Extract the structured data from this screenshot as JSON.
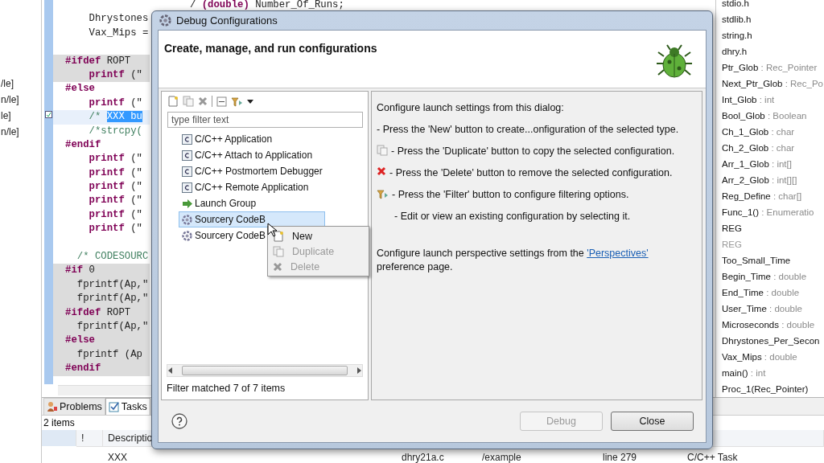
{
  "explorer": {
    "items": [
      "/le]",
      "n/le]",
      "le]",
      "n/le]"
    ]
  },
  "editor": {
    "lines": [
      {
        "shaded": false,
        "current": false,
        "parts": [
          {
            "kind": "plain",
            "text": "                     / "
          },
          {
            "kind": "kw",
            "text": "(double)"
          },
          {
            "kind": "plain",
            "text": " Number_Of_Runs;"
          }
        ]
      },
      {
        "shaded": false,
        "current": false,
        "parts": [
          {
            "kind": "plain",
            "text": "    Dhrystones"
          }
        ]
      },
      {
        "shaded": false,
        "current": false,
        "parts": [
          {
            "kind": "plain",
            "text": "    Vax_Mips ="
          }
        ]
      },
      {
        "shaded": false,
        "current": false
      },
      {
        "shaded": true,
        "current": false,
        "parts": [
          {
            "kind": "kw",
            "text": "#ifdef"
          },
          {
            "kind": "plain",
            "text": " ROPT"
          }
        ]
      },
      {
        "shaded": true,
        "current": false,
        "parts": [
          {
            "kind": "kw",
            "text": "    printf"
          },
          {
            "kind": "plain",
            "text": " (\""
          }
        ]
      },
      {
        "shaded": false,
        "current": false,
        "parts": [
          {
            "kind": "kw",
            "text": "#else"
          }
        ]
      },
      {
        "shaded": false,
        "current": false,
        "parts": [
          {
            "kind": "kw",
            "text": "    printf"
          },
          {
            "kind": "plain",
            "text": " (\""
          }
        ]
      },
      {
        "shaded": false,
        "current": true,
        "parts": [
          {
            "kind": "comment",
            "text": "    /* "
          },
          {
            "kind": "sel",
            "text": "XXX bu"
          }
        ]
      },
      {
        "shaded": false,
        "current": false,
        "parts": [
          {
            "kind": "comment",
            "text": "    /*strcpy("
          }
        ]
      },
      {
        "shaded": false,
        "current": false,
        "parts": [
          {
            "kind": "kw",
            "text": "#endif"
          }
        ]
      },
      {
        "shaded": false,
        "current": false,
        "parts": [
          {
            "kind": "kw",
            "text": "    printf"
          },
          {
            "kind": "plain",
            "text": " (\""
          }
        ]
      },
      {
        "shaded": false,
        "current": false,
        "parts": [
          {
            "kind": "kw",
            "text": "    printf"
          },
          {
            "kind": "plain",
            "text": " (\""
          }
        ]
      },
      {
        "shaded": false,
        "current": false,
        "parts": [
          {
            "kind": "kw",
            "text": "    printf"
          },
          {
            "kind": "plain",
            "text": " (\""
          }
        ]
      },
      {
        "shaded": false,
        "current": false,
        "parts": [
          {
            "kind": "kw",
            "text": "    printf"
          },
          {
            "kind": "plain",
            "text": " (\""
          }
        ]
      },
      {
        "shaded": false,
        "current": false,
        "parts": [
          {
            "kind": "kw",
            "text": "    printf"
          },
          {
            "kind": "plain",
            "text": " (\""
          }
        ]
      },
      {
        "shaded": false,
        "current": false,
        "parts": [
          {
            "kind": "kw",
            "text": "    printf"
          },
          {
            "kind": "plain",
            "text": " (\""
          }
        ]
      },
      {
        "shaded": false,
        "current": false
      },
      {
        "shaded": false,
        "current": false,
        "parts": [
          {
            "kind": "comment",
            "text": "  /* CODESOURC"
          }
        ]
      },
      {
        "shaded": true,
        "current": false,
        "parts": [
          {
            "kind": "kw",
            "text": "#if"
          },
          {
            "kind": "plain",
            "text": " 0"
          }
        ]
      },
      {
        "shaded": true,
        "current": false,
        "parts": [
          {
            "kind": "plain",
            "text": "  fprintf(Ap,\""
          }
        ]
      },
      {
        "shaded": true,
        "current": false,
        "parts": [
          {
            "kind": "plain",
            "text": "  fprintf(Ap,\""
          }
        ]
      },
      {
        "shaded": true,
        "current": false,
        "parts": [
          {
            "kind": "kw",
            "text": "#ifdef"
          },
          {
            "kind": "plain",
            "text": " ROPT"
          }
        ]
      },
      {
        "shaded": true,
        "current": false,
        "parts": [
          {
            "kind": "plain",
            "text": "  fprintf(Ap,\""
          }
        ]
      },
      {
        "shaded": true,
        "current": false,
        "parts": [
          {
            "kind": "kw",
            "text": "#else"
          }
        ]
      },
      {
        "shaded": true,
        "current": false,
        "parts": [
          {
            "kind": "plain",
            "text": "  fprintf (Ap"
          }
        ]
      },
      {
        "shaded": true,
        "current": false,
        "parts": [
          {
            "kind": "kw",
            "text": "#endif"
          }
        ]
      }
    ]
  },
  "outline": {
    "items": [
      {
        "name": "stdio.h",
        "disabled": false
      },
      {
        "name": "stdlib.h",
        "disabled": false
      },
      {
        "name": "string.h",
        "disabled": false
      },
      {
        "name": "dhry.h",
        "disabled": false
      },
      {
        "name": "Ptr_Glob",
        "type": ": Rec_Pointer",
        "disabled": false
      },
      {
        "name": "Next_Ptr_Glob",
        "type": ": Rec_Po",
        "disabled": false
      },
      {
        "name": "Int_Glob",
        "type": ": int",
        "disabled": false
      },
      {
        "name": "Bool_Glob",
        "type": ": Boolean",
        "disabled": false
      },
      {
        "name": "Ch_1_Glob",
        "type": ": char",
        "disabled": false
      },
      {
        "name": "Ch_2_Glob",
        "type": ": char",
        "disabled": false
      },
      {
        "name": "Arr_1_Glob",
        "type": ": int[]",
        "disabled": false
      },
      {
        "name": "Arr_2_Glob",
        "type": ": int[][]",
        "disabled": false
      },
      {
        "name": "Reg_Define",
        "type": ": char[]",
        "disabled": false
      },
      {
        "name": "Func_1()",
        "type": ": Enumeratio",
        "disabled": false
      },
      {
        "name": "REG",
        "disabled": false
      },
      {
        "name": "REG",
        "disabled": true
      },
      {
        "name": "Too_Small_Time",
        "disabled": false
      },
      {
        "name": "Begin_Time",
        "type": ": double",
        "disabled": false
      },
      {
        "name": "End_Time",
        "type": ": double",
        "disabled": false
      },
      {
        "name": "User_Time",
        "type": ": double",
        "disabled": false
      },
      {
        "name": "Microseconds",
        "type": ": double",
        "disabled": false
      },
      {
        "name": "Dhrystones_Per_Secon",
        "disabled": false
      },
      {
        "name": "Vax_Mips",
        "type": ": double",
        "disabled": false
      },
      {
        "name": "main()",
        "type": ": int",
        "disabled": false
      },
      {
        "name": "Proc_1(Rec_Pointer)",
        "disabled": false
      }
    ]
  },
  "bottom_panel": {
    "tabs": [
      {
        "label": "Problems",
        "selected": false
      },
      {
        "label": "Tasks",
        "selected": true
      }
    ],
    "summary": "2 items",
    "columns": [
      "!",
      "Descriptio"
    ],
    "row": [
      "XXX",
      "dhry21a.c",
      "/example",
      "line 279",
      "C/C++ Task"
    ]
  },
  "dialog": {
    "title": "Debug Configurations",
    "heading": "Create, manage, and run configurations",
    "toolbar": [
      {
        "kind": "new"
      },
      {
        "kind": "duplicate"
      },
      {
        "kind": "delete"
      },
      {
        "kind": "separator"
      },
      {
        "kind": "collapse"
      },
      {
        "kind": "filter"
      },
      {
        "kind": "dropdown"
      }
    ],
    "filter": {
      "placeholder": "type filter text"
    },
    "tree": [
      {
        "label": "C/C++ Application",
        "kind": "c",
        "selected": false
      },
      {
        "label": "C/C++ Attach to Application",
        "kind": "c",
        "selected": false
      },
      {
        "label": "C/C++ Postmortem Debugger",
        "kind": "c",
        "selected": false
      },
      {
        "label": "C/C++ Remote Application",
        "kind": "c",
        "selected": false
      },
      {
        "label": "Launch Group",
        "kind": "launch",
        "selected": false
      },
      {
        "label": "Sourcery CodeB",
        "kind": "sourcery",
        "selected": true
      },
      {
        "label": "Sourcery CodeB",
        "kind": "sourcery",
        "selected": false
      }
    ],
    "status": "Filter matched 7 of 7 items",
    "info": {
      "intro": "Configure launch settings from this dialog:",
      "lines": [
        {
          "kind": "plain",
          "text": "- Press the 'New' button to create...onfiguration of the selected type."
        },
        {
          "kind": "duplicate",
          "text": "- Press the 'Duplicate' button to copy the selected configuration."
        },
        {
          "kind": "delete",
          "text": "- Press the 'Delete' button to remove the selected configuration."
        },
        {
          "kind": "filter",
          "text": "- Press the 'Filter' button to configure filtering options."
        },
        {
          "kind": "indented",
          "text": "- Edit or view an existing configuration by selecting it."
        }
      ],
      "footer": "Configure launch perspective settings from the ",
      "link": "'Perspectives'",
      "footer_end": "preference page."
    },
    "buttons": [
      {
        "label": "Debug",
        "disabled": true
      },
      {
        "label": "Close",
        "disabled": false
      }
    ],
    "context_menu": [
      {
        "label": "New",
        "kind": "new",
        "disabled": false
      },
      {
        "label": "Duplicate",
        "kind": "duplicate",
        "disabled": true
      },
      {
        "label": "Delete",
        "kind": "delete",
        "disabled": true
      }
    ]
  }
}
